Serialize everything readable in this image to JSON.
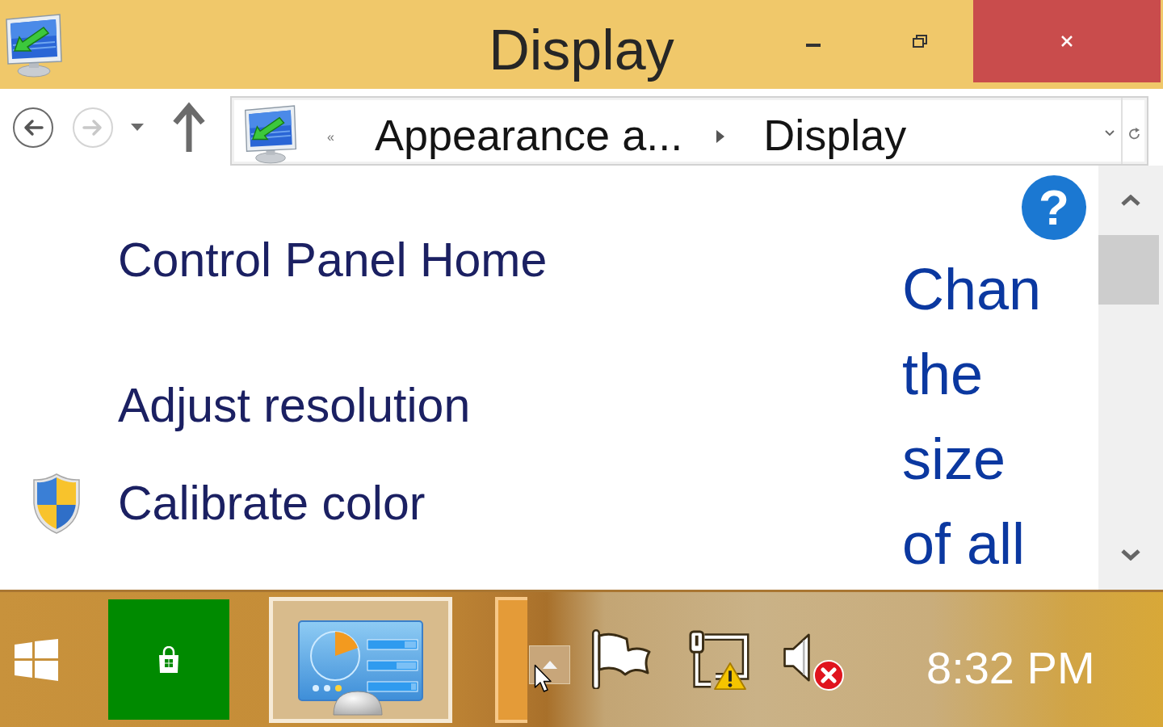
{
  "window": {
    "title": "Display"
  },
  "toolbar": {
    "nav": [
      {
        "kind": "back",
        "disabled": false
      },
      {
        "kind": "forward",
        "disabled": true
      }
    ],
    "address_bar": {
      "overflow": "«",
      "crumbs": [
        "Appearance a...",
        "Display"
      ]
    }
  },
  "sidebar": {
    "home_link": "Control Panel Home",
    "links": [
      {
        "label": "Adjust resolution",
        "shield": false
      },
      {
        "label": "Calibrate color",
        "shield": true
      }
    ]
  },
  "main": {
    "help": "?",
    "heading": "Chan the size of all"
  },
  "taskbar": {
    "apps": [
      {
        "kind": "store",
        "selected": false,
        "flashing": false
      },
      {
        "kind": "control-panel",
        "selected": true,
        "flashing": false
      },
      {
        "kind": "window",
        "selected": false,
        "flashing": true
      }
    ],
    "tray": {
      "icons": [
        {
          "kind": "flag",
          "badge": false
        },
        {
          "kind": "network",
          "badge": true
        },
        {
          "kind": "volume",
          "badge": true
        }
      ],
      "clock": "8:32 PM"
    }
  }
}
